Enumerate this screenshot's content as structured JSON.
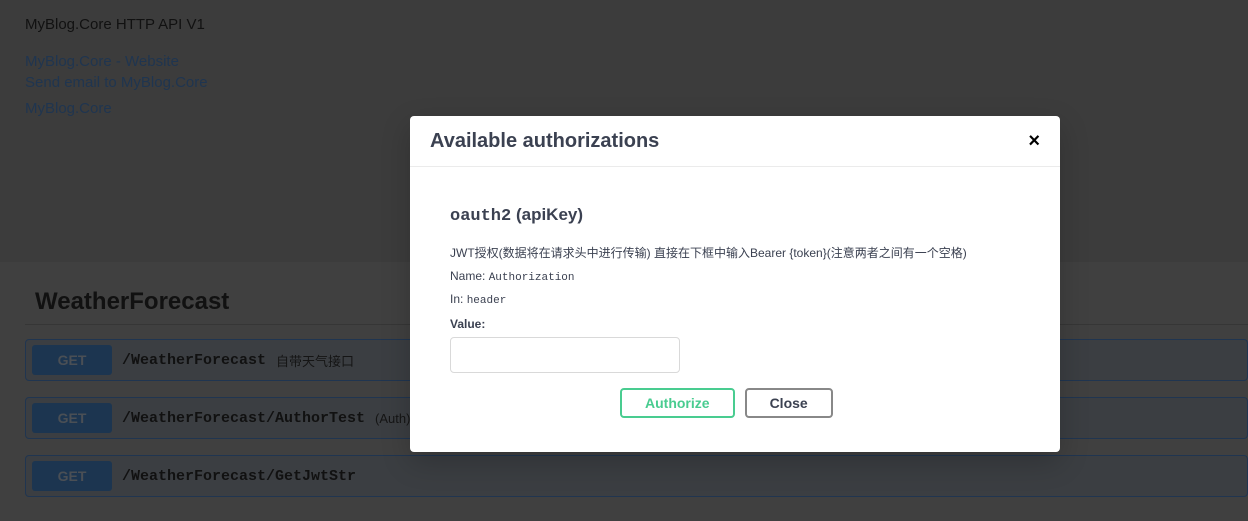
{
  "info": {
    "title": "MyBlog.Core HTTP API V1",
    "links": [
      "MyBlog.Core - Website",
      "Send email to MyBlog.Core",
      "MyBlog.Core"
    ]
  },
  "tag": "WeatherForecast",
  "operations": [
    {
      "method": "GET",
      "path": "/WeatherForecast",
      "summary": "自带天气接口"
    },
    {
      "method": "GET",
      "path": "/WeatherForecast/AuthorTest",
      "summary": "(Auth)"
    },
    {
      "method": "GET",
      "path": "/WeatherForecast/GetJwtStr",
      "summary": ""
    }
  ],
  "modal": {
    "title": "Available authorizations",
    "close_icon": "×",
    "scheme_name": "oauth2",
    "scheme_type": "(apiKey)",
    "description": "JWT授权(数据将在请求头中进行传输) 直接在下框中输入Bearer {token}(注意两者之间有一个空格)",
    "name_label": "Name:",
    "name_value": "Authorization",
    "in_label": "In:",
    "in_value": "header",
    "value_label": "Value:",
    "value": "",
    "authorize_label": "Authorize",
    "close_label": "Close"
  }
}
